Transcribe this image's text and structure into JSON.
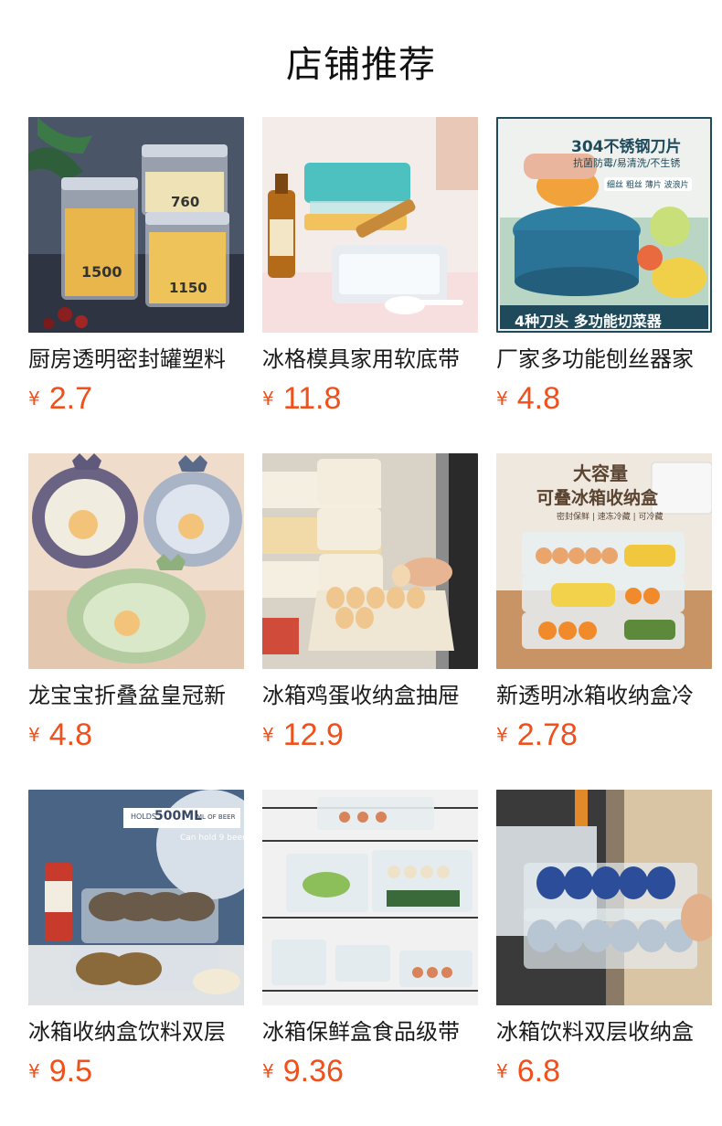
{
  "header": {
    "title": "店铺推荐"
  },
  "currency_symbol": "¥",
  "products": [
    {
      "name": "厨房透明密封罐塑料",
      "price": "2.7",
      "image_icon": "food-storage-jars-icon",
      "image_labels": [
        "1500",
        "760",
        "1150"
      ]
    },
    {
      "name": "冰格模具家用软底带",
      "price": "11.8",
      "image_icon": "ice-cube-tray-icon",
      "image_labels": []
    },
    {
      "name": "厂家多功能刨丝器家",
      "price": "4.8",
      "image_icon": "vegetable-slicer-icon",
      "image_labels": [
        "304不锈钢刀片",
        "抗菌防霉/易清洗/不生锈",
        "细丝 粗丝 薄片 波浪片",
        "4种刀头 多功能切菜器"
      ]
    },
    {
      "name": "龙宝宝折叠盆皇冠新",
      "price": "4.8",
      "image_icon": "foldable-basin-icon",
      "image_labels": []
    },
    {
      "name": "冰箱鸡蛋收纳盒抽屉",
      "price": "12.9",
      "image_icon": "egg-drawer-icon",
      "image_labels": []
    },
    {
      "name": "新透明冰箱收纳盒冷",
      "price": "2.78",
      "image_icon": "fridge-storage-box-icon",
      "image_labels": [
        "大容量",
        "可叠冰箱收纳盒",
        "密封保鲜 | 速冻冷藏 | 可冷藏"
      ]
    },
    {
      "name": "冰箱收纳盒饮料双层",
      "price": "9.5",
      "image_icon": "can-organizer-icon",
      "image_labels": [
        "HOLDS",
        "500ML",
        "ML OF BEER",
        "Can hold 9 beer"
      ]
    },
    {
      "name": "冰箱保鲜盒食品级带",
      "price": "9.36",
      "image_icon": "fresh-keeping-box-icon",
      "image_labels": []
    },
    {
      "name": "冰箱饮料双层收纳盒",
      "price": "6.8",
      "image_icon": "double-layer-can-rack-icon",
      "image_labels": []
    }
  ]
}
